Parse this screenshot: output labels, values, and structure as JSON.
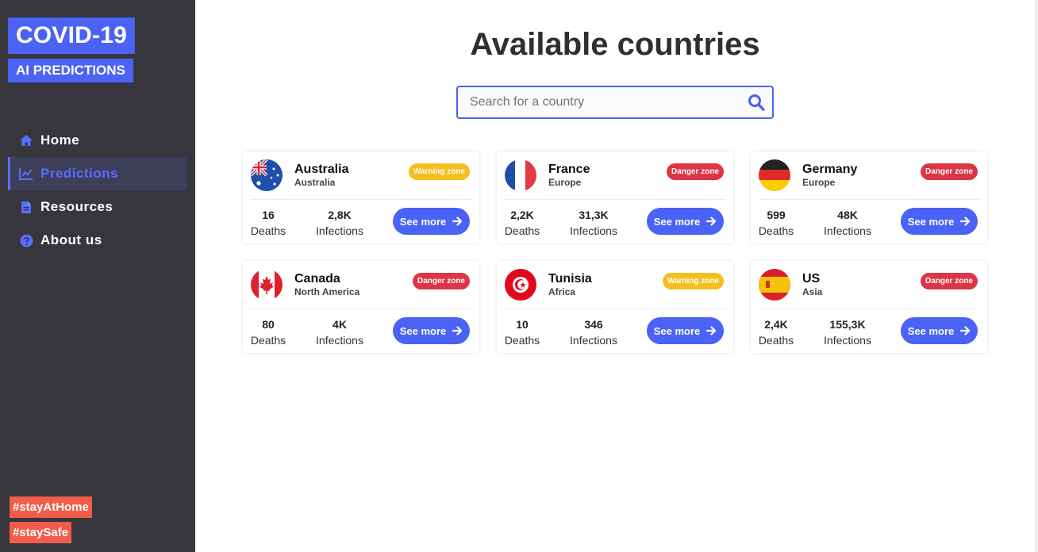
{
  "sidebar": {
    "logo_top": "COVID-19",
    "logo_bottom": "AI PREDICTIONS",
    "nav": [
      {
        "label": "Home",
        "icon": "home-icon",
        "active": false
      },
      {
        "label": "Predictions",
        "icon": "chart-line-icon",
        "active": true
      },
      {
        "label": "Resources",
        "icon": "file-icon",
        "active": false
      },
      {
        "label": "About us",
        "icon": "question-circle-icon",
        "active": false
      }
    ],
    "tags": [
      "#stayAtHome",
      "#staySafe"
    ]
  },
  "main": {
    "title": "Available countries",
    "search": {
      "placeholder": "Search for a country",
      "value": ""
    },
    "cards": [
      {
        "name": "Australia",
        "region": "Australia",
        "zone": "Warning zone",
        "deaths": "16",
        "infections": "2,8K",
        "deaths_label": "Deaths",
        "infections_label": "Infections",
        "button": "See more",
        "flag": "australia-flag-icon"
      },
      {
        "name": "France",
        "region": "Europe",
        "zone": "Danger zone",
        "deaths": "2,2K",
        "infections": "31,3K",
        "deaths_label": "Deaths",
        "infections_label": "Infections",
        "button": "See more",
        "flag": "france-flag-icon"
      },
      {
        "name": "Germany",
        "region": "Europe",
        "zone": "Danger zone",
        "deaths": "599",
        "infections": "48K",
        "deaths_label": "Deaths",
        "infections_label": "Infections",
        "button": "See more",
        "flag": "germany-flag-icon"
      },
      {
        "name": "Canada",
        "region": "North America",
        "zone": "Danger zone",
        "deaths": "80",
        "infections": "4K",
        "deaths_label": "Deaths",
        "infections_label": "Infections",
        "button": "See more",
        "flag": "canada-flag-icon"
      },
      {
        "name": "Tunisia",
        "region": "Africa",
        "zone": "Warning zone",
        "deaths": "10",
        "infections": "346",
        "deaths_label": "Deaths",
        "infections_label": "Infections",
        "button": "See more",
        "flag": "tunisia-flag-icon"
      },
      {
        "name": "US",
        "region": "Asia",
        "zone": "Danger zone",
        "deaths": "2,4K",
        "infections": "155,3K",
        "deaths_label": "Deaths",
        "infections_label": "Infections",
        "button": "See more",
        "flag": "spain-flag-icon"
      }
    ]
  },
  "colors": {
    "sidebar_bg": "#36363c",
    "accent": "#4a63f5",
    "warning": "#f5bf1f",
    "danger": "#dc3545",
    "tag": "#f25c4a"
  }
}
